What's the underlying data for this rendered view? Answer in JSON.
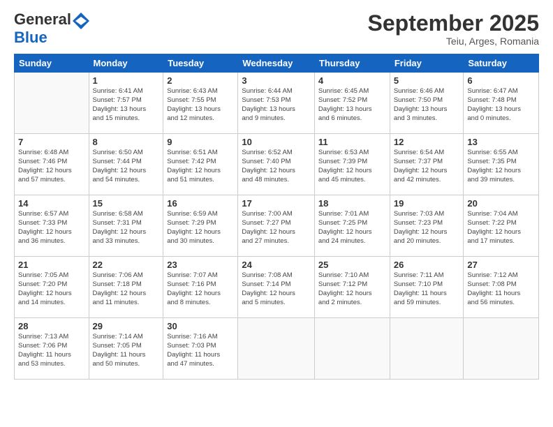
{
  "header": {
    "logo_general": "General",
    "logo_blue": "Blue",
    "month_title": "September 2025",
    "subtitle": "Teiu, Arges, Romania"
  },
  "weekdays": [
    "Sunday",
    "Monday",
    "Tuesday",
    "Wednesday",
    "Thursday",
    "Friday",
    "Saturday"
  ],
  "weeks": [
    [
      {
        "day": "",
        "info": ""
      },
      {
        "day": "1",
        "info": "Sunrise: 6:41 AM\nSunset: 7:57 PM\nDaylight: 13 hours\nand 15 minutes."
      },
      {
        "day": "2",
        "info": "Sunrise: 6:43 AM\nSunset: 7:55 PM\nDaylight: 13 hours\nand 12 minutes."
      },
      {
        "day": "3",
        "info": "Sunrise: 6:44 AM\nSunset: 7:53 PM\nDaylight: 13 hours\nand 9 minutes."
      },
      {
        "day": "4",
        "info": "Sunrise: 6:45 AM\nSunset: 7:52 PM\nDaylight: 13 hours\nand 6 minutes."
      },
      {
        "day": "5",
        "info": "Sunrise: 6:46 AM\nSunset: 7:50 PM\nDaylight: 13 hours\nand 3 minutes."
      },
      {
        "day": "6",
        "info": "Sunrise: 6:47 AM\nSunset: 7:48 PM\nDaylight: 13 hours\nand 0 minutes."
      }
    ],
    [
      {
        "day": "7",
        "info": "Sunrise: 6:48 AM\nSunset: 7:46 PM\nDaylight: 12 hours\nand 57 minutes."
      },
      {
        "day": "8",
        "info": "Sunrise: 6:50 AM\nSunset: 7:44 PM\nDaylight: 12 hours\nand 54 minutes."
      },
      {
        "day": "9",
        "info": "Sunrise: 6:51 AM\nSunset: 7:42 PM\nDaylight: 12 hours\nand 51 minutes."
      },
      {
        "day": "10",
        "info": "Sunrise: 6:52 AM\nSunset: 7:40 PM\nDaylight: 12 hours\nand 48 minutes."
      },
      {
        "day": "11",
        "info": "Sunrise: 6:53 AM\nSunset: 7:39 PM\nDaylight: 12 hours\nand 45 minutes."
      },
      {
        "day": "12",
        "info": "Sunrise: 6:54 AM\nSunset: 7:37 PM\nDaylight: 12 hours\nand 42 minutes."
      },
      {
        "day": "13",
        "info": "Sunrise: 6:55 AM\nSunset: 7:35 PM\nDaylight: 12 hours\nand 39 minutes."
      }
    ],
    [
      {
        "day": "14",
        "info": "Sunrise: 6:57 AM\nSunset: 7:33 PM\nDaylight: 12 hours\nand 36 minutes."
      },
      {
        "day": "15",
        "info": "Sunrise: 6:58 AM\nSunset: 7:31 PM\nDaylight: 12 hours\nand 33 minutes."
      },
      {
        "day": "16",
        "info": "Sunrise: 6:59 AM\nSunset: 7:29 PM\nDaylight: 12 hours\nand 30 minutes."
      },
      {
        "day": "17",
        "info": "Sunrise: 7:00 AM\nSunset: 7:27 PM\nDaylight: 12 hours\nand 27 minutes."
      },
      {
        "day": "18",
        "info": "Sunrise: 7:01 AM\nSunset: 7:25 PM\nDaylight: 12 hours\nand 24 minutes."
      },
      {
        "day": "19",
        "info": "Sunrise: 7:03 AM\nSunset: 7:23 PM\nDaylight: 12 hours\nand 20 minutes."
      },
      {
        "day": "20",
        "info": "Sunrise: 7:04 AM\nSunset: 7:22 PM\nDaylight: 12 hours\nand 17 minutes."
      }
    ],
    [
      {
        "day": "21",
        "info": "Sunrise: 7:05 AM\nSunset: 7:20 PM\nDaylight: 12 hours\nand 14 minutes."
      },
      {
        "day": "22",
        "info": "Sunrise: 7:06 AM\nSunset: 7:18 PM\nDaylight: 12 hours\nand 11 minutes."
      },
      {
        "day": "23",
        "info": "Sunrise: 7:07 AM\nSunset: 7:16 PM\nDaylight: 12 hours\nand 8 minutes."
      },
      {
        "day": "24",
        "info": "Sunrise: 7:08 AM\nSunset: 7:14 PM\nDaylight: 12 hours\nand 5 minutes."
      },
      {
        "day": "25",
        "info": "Sunrise: 7:10 AM\nSunset: 7:12 PM\nDaylight: 12 hours\nand 2 minutes."
      },
      {
        "day": "26",
        "info": "Sunrise: 7:11 AM\nSunset: 7:10 PM\nDaylight: 11 hours\nand 59 minutes."
      },
      {
        "day": "27",
        "info": "Sunrise: 7:12 AM\nSunset: 7:08 PM\nDaylight: 11 hours\nand 56 minutes."
      }
    ],
    [
      {
        "day": "28",
        "info": "Sunrise: 7:13 AM\nSunset: 7:06 PM\nDaylight: 11 hours\nand 53 minutes."
      },
      {
        "day": "29",
        "info": "Sunrise: 7:14 AM\nSunset: 7:05 PM\nDaylight: 11 hours\nand 50 minutes."
      },
      {
        "day": "30",
        "info": "Sunrise: 7:16 AM\nSunset: 7:03 PM\nDaylight: 11 hours\nand 47 minutes."
      },
      {
        "day": "",
        "info": ""
      },
      {
        "day": "",
        "info": ""
      },
      {
        "day": "",
        "info": ""
      },
      {
        "day": "",
        "info": ""
      }
    ]
  ]
}
